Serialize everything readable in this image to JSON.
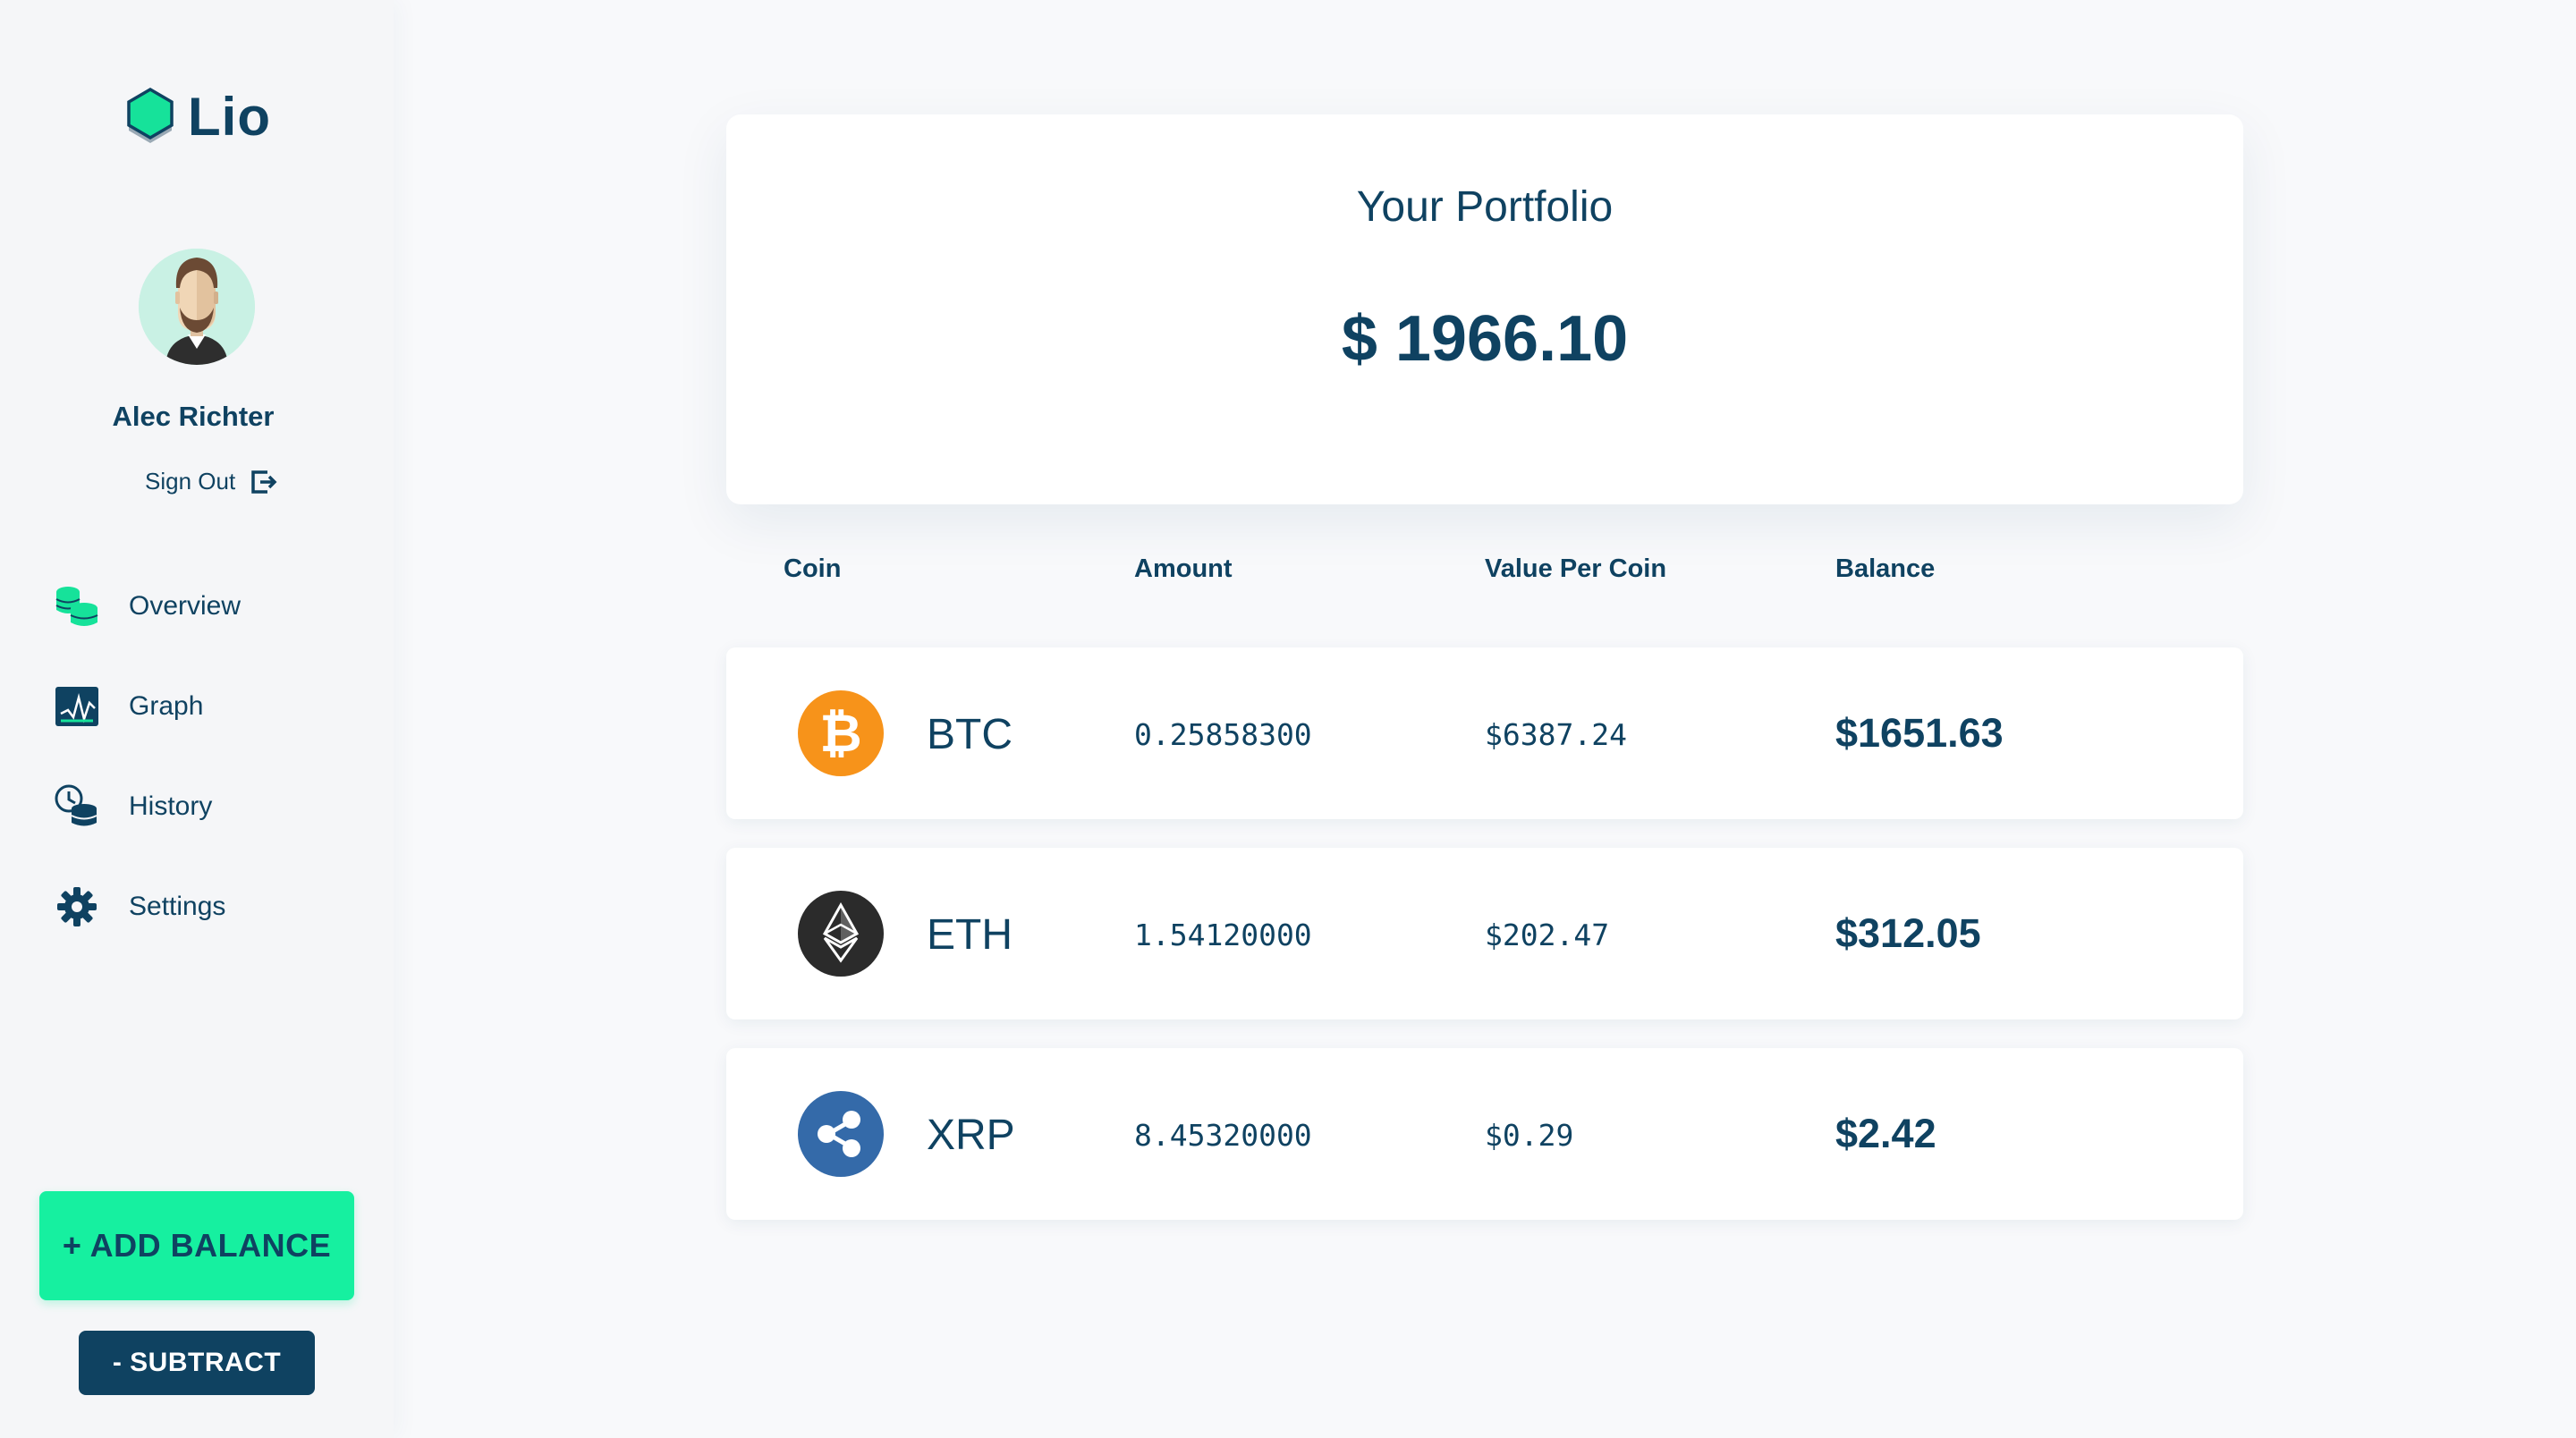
{
  "app": {
    "name": "Lio"
  },
  "user": {
    "name": "Alec Richter",
    "signout_label": "Sign Out"
  },
  "nav": [
    {
      "label": "Overview",
      "icon": "coins-stack-icon"
    },
    {
      "label": "Graph",
      "icon": "chart-icon"
    },
    {
      "label": "History",
      "icon": "history-icon"
    },
    {
      "label": "Settings",
      "icon": "gear-icon"
    }
  ],
  "actions": {
    "add_label": "+ ADD BALANCE",
    "subtract_label": "- SUBTRACT"
  },
  "portfolio": {
    "title": "Your Portfolio",
    "total": "$ 1966.10"
  },
  "table": {
    "headers": [
      "Coin",
      "Amount",
      "Value Per Coin",
      "Balance"
    ],
    "rows": [
      {
        "symbol": "BTC",
        "amount": "0.25858300",
        "value": "$6387.24",
        "balance": "$1651.63",
        "icon": "bitcoin-icon",
        "color": "#f7931a"
      },
      {
        "symbol": "ETH",
        "amount": "1.54120000",
        "value": "$202.47",
        "balance": "$312.05",
        "icon": "ethereum-icon",
        "color": "#2b2b2b"
      },
      {
        "symbol": "XRP",
        "amount": "8.45320000",
        "value": "$0.29",
        "balance": "$2.42",
        "icon": "ripple-icon",
        "color": "#346aa9"
      }
    ]
  },
  "colors": {
    "primary": "#0f4261",
    "accent": "#16f0a0",
    "background": "#f8f9fb",
    "card": "#ffffff"
  }
}
